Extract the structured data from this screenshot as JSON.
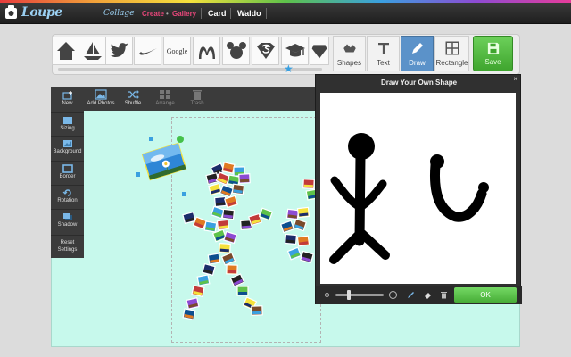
{
  "app": {
    "brand": "Loupe",
    "brand_suffix": "Collage",
    "nav": [
      "Create",
      "Gallery"
    ],
    "links": [
      "Card",
      "Waldo"
    ]
  },
  "shapes": [
    {
      "name": "house-icon"
    },
    {
      "name": "sailboat-icon"
    },
    {
      "name": "twitter-bird-icon"
    },
    {
      "name": "nike-swoosh-icon"
    },
    {
      "name": "google-logo",
      "text": "Google"
    },
    {
      "name": "mcdonalds-arches-icon"
    },
    {
      "name": "mickey-mouse-icon"
    },
    {
      "name": "superman-logo-icon"
    },
    {
      "name": "graduation-cap-icon"
    },
    {
      "name": "diamond-icon"
    }
  ],
  "tools": {
    "shapes": "Shapes",
    "text": "Text",
    "draw": "Draw",
    "rectangle": "Rectangle",
    "save": "Save"
  },
  "photo_actions": {
    "add_photos": "Add Photos",
    "shuffle": "Shuffle",
    "arrange": "Arrange",
    "trash": "Trash"
  },
  "side_actions": [
    "New",
    "Sizing",
    "Background",
    "Border",
    "Rotation",
    "Shadow",
    "Reset Settings"
  ],
  "dialog": {
    "title": "Draw Your Own Shape",
    "ok_label": "OK",
    "close_label": "×",
    "brush_size": 0.25
  },
  "colors": {
    "accent_green": "#47ad37",
    "canvas": "#c7f9ec",
    "active_tool": "#5b92c9"
  }
}
